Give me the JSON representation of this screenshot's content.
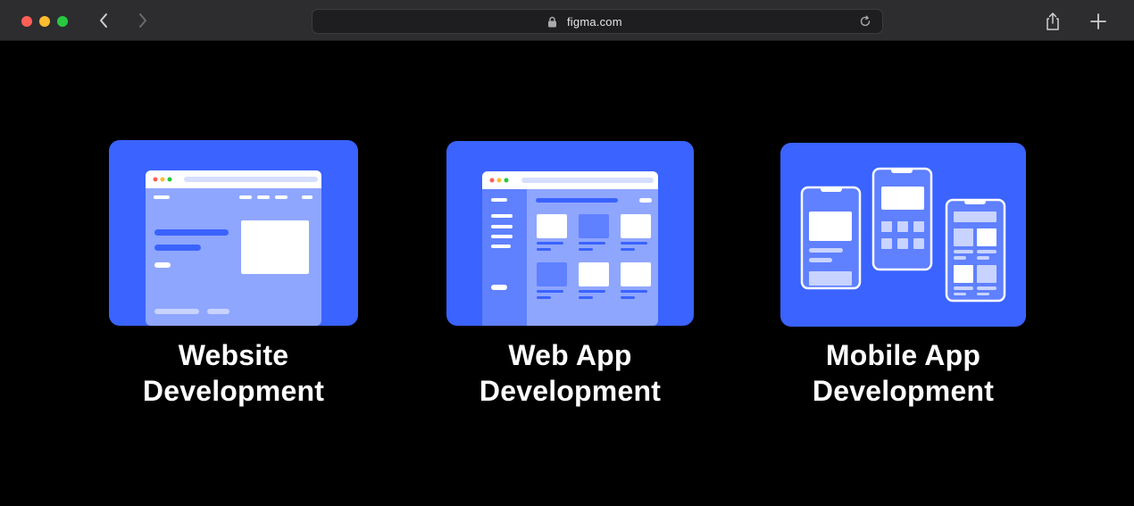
{
  "browser": {
    "url": "figma.com",
    "icons": {
      "back": "chevron-left-icon",
      "forward": "chevron-right-icon",
      "lock": "lock-icon",
      "reload": "reload-icon",
      "share": "share-icon",
      "new_tab": "plus-icon"
    }
  },
  "services": [
    {
      "line1": "Website",
      "line2": "Development"
    },
    {
      "line1": "Web App",
      "line2": "Development"
    },
    {
      "line1": "Mobile App",
      "line2": "Development"
    }
  ],
  "colors": {
    "background": "#000000",
    "tile_blue": "#3a63ff",
    "light_blue": "#8fa6ff",
    "text": "#ffffff"
  }
}
